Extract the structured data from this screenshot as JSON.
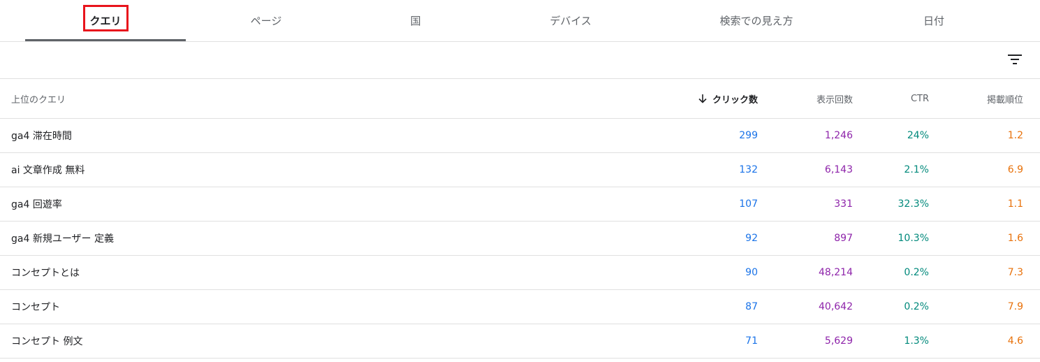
{
  "tabs": [
    {
      "label": "クエリ",
      "active": true
    },
    {
      "label": "ページ",
      "active": false
    },
    {
      "label": "国",
      "active": false
    },
    {
      "label": "デバイス",
      "active": false
    },
    {
      "label": "検索での見え方",
      "active": false
    },
    {
      "label": "日付",
      "active": false
    }
  ],
  "toolbar": {
    "filter_icon": "filter-list-icon"
  },
  "table": {
    "headers": {
      "query": "上位のクエリ",
      "clicks": "クリック数",
      "impressions": "表示回数",
      "ctr": "CTR",
      "position": "掲載順位"
    },
    "sort": {
      "column": "clicks",
      "direction": "desc",
      "icon": "arrow-down-icon"
    },
    "rows": [
      {
        "query": "ga4 滞在時間",
        "clicks": "299",
        "impressions": "1,246",
        "ctr": "24%",
        "position": "1.2"
      },
      {
        "query": "ai 文章作成 無料",
        "clicks": "132",
        "impressions": "6,143",
        "ctr": "2.1%",
        "position": "6.9"
      },
      {
        "query": "ga4 回遊率",
        "clicks": "107",
        "impressions": "331",
        "ctr": "32.3%",
        "position": "1.1"
      },
      {
        "query": "ga4 新規ユーザー 定義",
        "clicks": "92",
        "impressions": "897",
        "ctr": "10.3%",
        "position": "1.6"
      },
      {
        "query": "コンセプトとは",
        "clicks": "90",
        "impressions": "48,214",
        "ctr": "0.2%",
        "position": "7.3"
      },
      {
        "query": "コンセプト",
        "clicks": "87",
        "impressions": "40,642",
        "ctr": "0.2%",
        "position": "7.9"
      },
      {
        "query": "コンセプト 例文",
        "clicks": "71",
        "impressions": "5,629",
        "ctr": "1.3%",
        "position": "4.6"
      }
    ]
  },
  "colors": {
    "clicks": "#1a73e8",
    "impressions": "#8e24aa",
    "ctr": "#00897b",
    "position": "#e8710a",
    "highlight": "#e8141c"
  }
}
